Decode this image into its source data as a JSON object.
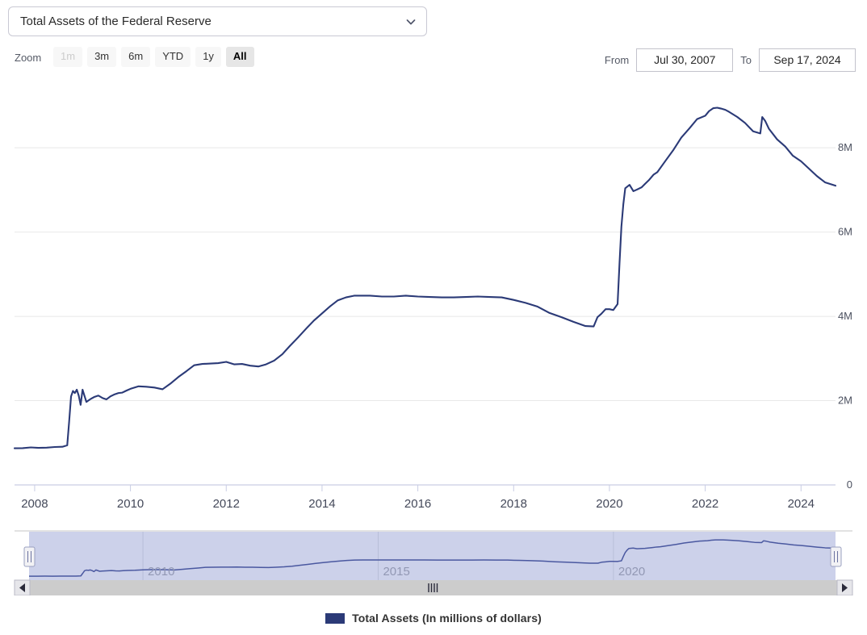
{
  "series_selector": {
    "selected": "Total Assets of the Federal Reserve",
    "chevron_icon": "chevron-down-icon"
  },
  "range_selector": {
    "zoom_label": "Zoom",
    "buttons": [
      {
        "label": "1m",
        "state": "disabled"
      },
      {
        "label": "3m",
        "state": "normal"
      },
      {
        "label": "6m",
        "state": "normal"
      },
      {
        "label": "YTD",
        "state": "normal"
      },
      {
        "label": "1y",
        "state": "normal"
      },
      {
        "label": "All",
        "state": "selected"
      }
    ],
    "from_label": "From",
    "from_value": "Jul 30, 2007",
    "to_label": "To",
    "to_value": "Sep 17, 2024"
  },
  "legend": {
    "swatch_color": "#2b3a77",
    "label": "Total Assets (In millions of dollars)"
  },
  "navigator": {
    "tick_labels": [
      "2010",
      "2015",
      "2020"
    ],
    "left_handle_icon": "navigator-left-handle",
    "right_handle_icon": "navigator-right-handle",
    "scrollbar_left_arrow_icon": "scroll-left-arrow-icon",
    "scrollbar_right_arrow_icon": "scroll-right-arrow-icon",
    "scrollbar_grip_icon": "scrollbar-grip-icon",
    "mask_color": "#ccd1ea",
    "series_line_color": "#4a58a0"
  },
  "chart_data": {
    "type": "line",
    "title": "",
    "xlabel": "",
    "ylabel": "",
    "series_name": "Total Assets (In millions of dollars)",
    "line_color": "#2b3a77",
    "grid": true,
    "legend_position": "bottom",
    "xlim": [
      2007.58,
      2024.72
    ],
    "ylim": [
      0,
      9400000
    ],
    "x_tick_labels": [
      "2008",
      "2010",
      "2012",
      "2014",
      "2016",
      "2018",
      "2020",
      "2022",
      "2024"
    ],
    "x_ticks": [
      2008,
      2010,
      2012,
      2014,
      2016,
      2018,
      2020,
      2022,
      2024
    ],
    "y_tick_labels": [
      "0",
      "2M",
      "4M",
      "6M",
      "8M"
    ],
    "y_ticks": [
      0,
      2000000,
      4000000,
      6000000,
      8000000
    ],
    "x": [
      2007.58,
      2007.75,
      2007.92,
      2008.08,
      2008.25,
      2008.42,
      2008.58,
      2008.68,
      2008.72,
      2008.76,
      2008.8,
      2008.84,
      2008.88,
      2008.92,
      2008.96,
      2009.0,
      2009.08,
      2009.17,
      2009.25,
      2009.33,
      2009.42,
      2009.5,
      2009.58,
      2009.67,
      2009.75,
      2009.83,
      2009.92,
      2010.0,
      2010.17,
      2010.33,
      2010.5,
      2010.67,
      2010.83,
      2011.0,
      2011.17,
      2011.33,
      2011.5,
      2011.67,
      2011.83,
      2012.0,
      2012.17,
      2012.33,
      2012.5,
      2012.67,
      2012.83,
      2013.0,
      2013.17,
      2013.33,
      2013.5,
      2013.67,
      2013.83,
      2014.0,
      2014.17,
      2014.33,
      2014.5,
      2014.67,
      2014.83,
      2015.0,
      2015.25,
      2015.5,
      2015.75,
      2016.0,
      2016.25,
      2016.5,
      2016.75,
      2017.0,
      2017.25,
      2017.5,
      2017.75,
      2018.0,
      2018.25,
      2018.5,
      2018.75,
      2019.0,
      2019.25,
      2019.5,
      2019.67,
      2019.75,
      2019.83,
      2019.92,
      2020.0,
      2020.08,
      2020.17,
      2020.21,
      2020.25,
      2020.29,
      2020.33,
      2020.42,
      2020.5,
      2020.58,
      2020.67,
      2020.75,
      2020.83,
      2020.92,
      2021.0,
      2021.17,
      2021.33,
      2021.5,
      2021.67,
      2021.83,
      2022.0,
      2022.08,
      2022.17,
      2022.25,
      2022.33,
      2022.42,
      2022.5,
      2022.67,
      2022.83,
      2023.0,
      2023.15,
      2023.19,
      2023.25,
      2023.33,
      2023.5,
      2023.67,
      2023.83,
      2024.0,
      2024.17,
      2024.33,
      2024.5,
      2024.72
    ],
    "y": [
      869000,
      872000,
      890000,
      880000,
      885000,
      900000,
      905000,
      940000,
      1500000,
      2100000,
      2230000,
      2180000,
      2260000,
      2120000,
      1900000,
      2260000,
      1970000,
      2040000,
      2090000,
      2120000,
      2060000,
      2030000,
      2100000,
      2150000,
      2180000,
      2190000,
      2240000,
      2280000,
      2340000,
      2330000,
      2310000,
      2270000,
      2400000,
      2560000,
      2700000,
      2840000,
      2870000,
      2880000,
      2890000,
      2920000,
      2860000,
      2870000,
      2830000,
      2810000,
      2860000,
      2950000,
      3100000,
      3300000,
      3500000,
      3710000,
      3900000,
      4070000,
      4240000,
      4380000,
      4450000,
      4490000,
      4490000,
      4490000,
      4470000,
      4470000,
      4490000,
      4470000,
      4460000,
      4450000,
      4450000,
      4460000,
      4470000,
      4460000,
      4450000,
      4390000,
      4320000,
      4230000,
      4080000,
      3980000,
      3870000,
      3770000,
      3760000,
      3980000,
      4060000,
      4170000,
      4170000,
      4150000,
      4290000,
      5250000,
      6130000,
      6660000,
      7040000,
      7120000,
      6970000,
      7010000,
      7060000,
      7150000,
      7240000,
      7360000,
      7420000,
      7690000,
      7940000,
      8240000,
      8460000,
      8680000,
      8760000,
      8870000,
      8940000,
      8950000,
      8930000,
      8900000,
      8850000,
      8730000,
      8590000,
      8390000,
      8340000,
      8730000,
      8640000,
      8450000,
      8200000,
      8030000,
      7810000,
      7680000,
      7500000,
      7330000,
      7180000,
      7100000
    ]
  }
}
